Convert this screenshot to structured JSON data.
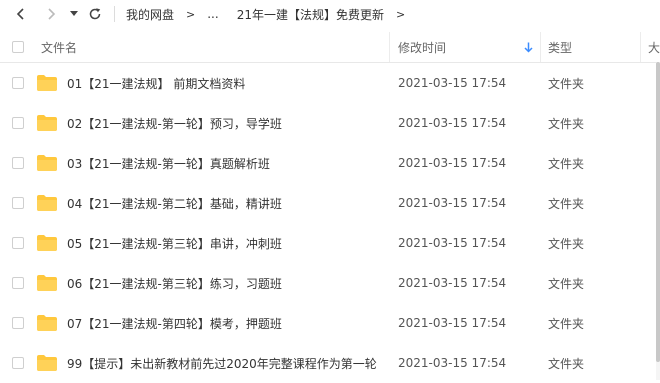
{
  "breadcrumb": {
    "root": "我的网盘",
    "ellipsis": "...",
    "current": "21年一建【法规】免费更新"
  },
  "columns": {
    "name": "文件名",
    "modified": "修改时间",
    "type": "类型",
    "size": "大"
  },
  "sort": {
    "column": "modified",
    "direction": "descending"
  },
  "colors": {
    "folder": "#FFC83D",
    "sort_arrow": "#3b8cff",
    "text": "#333333"
  },
  "files": [
    {
      "name": "01【21一建法规】 前期文档资料",
      "modified": "2021-03-15 17:54",
      "type": "文件夹"
    },
    {
      "name": "02【21一建法规-第一轮】预习，导学班",
      "modified": "2021-03-15 17:54",
      "type": "文件夹"
    },
    {
      "name": "03【21一建法规-第一轮】真题解析班",
      "modified": "2021-03-15 17:54",
      "type": "文件夹"
    },
    {
      "name": "04【21一建法规-第二轮】基础，精讲班",
      "modified": "2021-03-15 17:54",
      "type": "文件夹"
    },
    {
      "name": "05【21一建法规-第三轮】串讲，冲刺班",
      "modified": "2021-03-15 17:54",
      "type": "文件夹"
    },
    {
      "name": "06【21一建法规-第三轮】练习，习题班",
      "modified": "2021-03-15 17:54",
      "type": "文件夹"
    },
    {
      "name": "07【21一建法规-第四轮】模考，押题班",
      "modified": "2021-03-15 17:54",
      "type": "文件夹"
    },
    {
      "name": "99【提示】未出新教材前先过2020年完整课程作为第一轮",
      "modified": "2021-03-15 17:54",
      "type": "文件夹"
    }
  ]
}
